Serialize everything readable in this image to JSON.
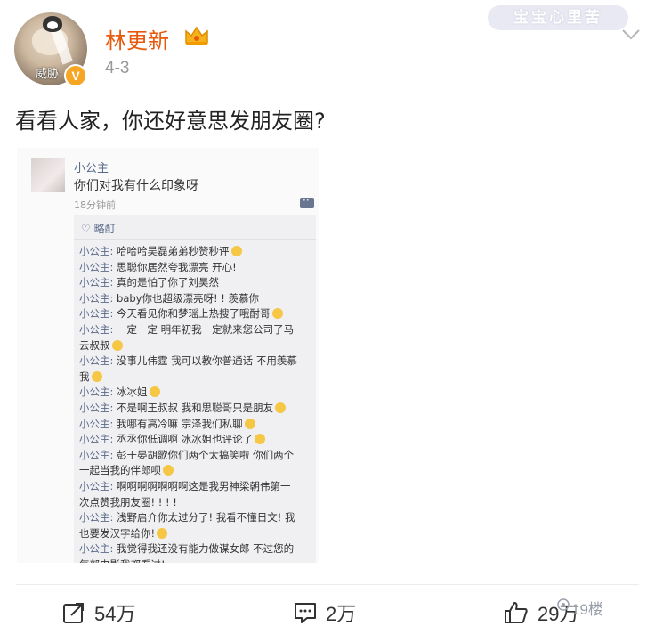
{
  "header": {
    "username": "林更新",
    "date": "4-3",
    "avatar_caption": "威胁",
    "verified_badge": "V",
    "top_watermark": "宝宝心里苦",
    "accent_color": "#e8590c"
  },
  "post": {
    "text": "看看人家，你还好意思发朋友圈?"
  },
  "embedded": {
    "name": "小公主",
    "message": "你们对我有什么印象呀",
    "time": "18分钟前",
    "like_label": "♡ 略酊",
    "comments": [
      {
        "who": "小公主:",
        "text": " 哈哈哈吴磊弟弟秒赞秒评"
      },
      {
        "who": "小公主:",
        "text": " 思聪你居然夸我漂亮 开心!"
      },
      {
        "who": "小公主:",
        "text": " 真的是怕了你了刘昊然"
      },
      {
        "who": "小公主:",
        "text": " baby你也超级漂亮呀! ! 羡慕你"
      },
      {
        "who": "小公主:",
        "text": " 今天看见你和梦瑶上热搜了哦酎哥"
      },
      {
        "who": "小公主:",
        "text": " 一定一定 明年初我一定就来您公司了马"
      },
      {
        "who": "",
        "text": "云叔叔"
      },
      {
        "who": "小公主:",
        "text": " 没事儿伟霆 我可以教你普通话 不用羡慕"
      },
      {
        "who": "",
        "text": "我"
      },
      {
        "who": "小公主:",
        "text": " 冰冰姐"
      },
      {
        "who": "小公主:",
        "text": " 不是啊王叔叔 我和思聪哥只是朋友"
      },
      {
        "who": "小公主:",
        "text": " 我哪有高冷嘛 宗泽我们私聊"
      },
      {
        "who": "小公主:",
        "text": " 丞丞你低调啊 冰冰姐也评论了"
      },
      {
        "who": "小公主:",
        "text": " 彭于晏胡歌你们两个太搞笑啦 你们两个"
      },
      {
        "who": "",
        "text": "一起当我的伴郎呗"
      },
      {
        "who": "小公主:",
        "text": " 啊啊啊啊啊啊啊这是我男神梁朝伟第一"
      },
      {
        "who": "",
        "text": "次点赞我朋友圈! ! ! !"
      },
      {
        "who": "小公主:",
        "text": " 浅野启介你太过分了! 我看不懂日文! 我"
      },
      {
        "who": "",
        "text": "也要发汉字给你!"
      },
      {
        "who": "小公主:",
        "text": " 我觉得我还没有能力做谋女郎 不过您的"
      },
      {
        "who": "",
        "text": "每部电影我都看过!"
      }
    ]
  },
  "actions": {
    "repost": "54万",
    "comment": "2万",
    "like": "29万",
    "watermark": "19楼"
  }
}
